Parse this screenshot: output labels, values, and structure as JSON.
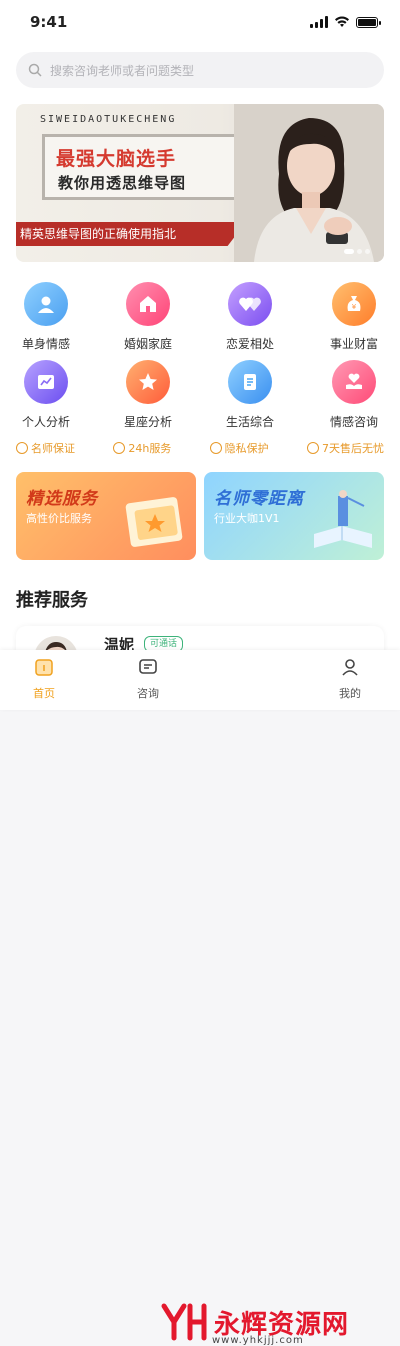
{
  "status": {
    "time": "9:41"
  },
  "search": {
    "placeholder": "搜索咨询老师或者问题类型"
  },
  "banner": {
    "brand": "SIWEIDAOTUKECHENG",
    "title": "最强大脑选手",
    "subtitle": "教你用透思维导图",
    "ribbon": "精英思维导图的正确使用指北"
  },
  "categories": [
    {
      "label": "单身情感",
      "icon": "person-icon",
      "color": "#5fb3f0"
    },
    {
      "label": "婚姻家庭",
      "icon": "house-icon",
      "color": "#ff5b8a"
    },
    {
      "label": "恋爱相处",
      "icon": "hearts-icon",
      "color": "#9b6cf0"
    },
    {
      "label": "事业财富",
      "icon": "money-bag-icon",
      "color": "#ff8f3a"
    },
    {
      "label": "个人分析",
      "icon": "chart-icon",
      "color": "#8a6cf5"
    },
    {
      "label": "星座分析",
      "icon": "star-icon",
      "color": "#ff7a3d"
    },
    {
      "label": "生活综合",
      "icon": "document-icon",
      "color": "#4aa6f2"
    },
    {
      "label": "情感咨询",
      "icon": "hand-heart-icon",
      "color": "#ff5c85"
    }
  ],
  "guarantees": [
    {
      "label": "名师保证",
      "icon": "teacher-icon"
    },
    {
      "label": "24h服务",
      "icon": "clock-icon"
    },
    {
      "label": "隐私保护",
      "icon": "shield-icon"
    },
    {
      "label": "7天售后无忧",
      "icon": "return-icon"
    }
  ],
  "cards": [
    {
      "title": "精选服务",
      "subtitle": "高性价比服务"
    },
    {
      "title": "名师零距离",
      "subtitle": "行业大咖1V1"
    }
  ],
  "section": {
    "title": "推荐服务"
  },
  "service": {
    "name": "温妮",
    "tag": "可通话"
  },
  "tabs": [
    {
      "label": "首页",
      "icon": "home-icon"
    },
    {
      "label": "咨询",
      "icon": "chat-icon"
    },
    {
      "label": "我的",
      "icon": "user-icon"
    }
  ],
  "watermark": {
    "text": "永辉资源网",
    "url": "www.yhkjjj.com"
  },
  "colors": {
    "accent": "#f0a11e",
    "guarantee": "#e79a2b",
    "ribbon": "#b72e28"
  }
}
